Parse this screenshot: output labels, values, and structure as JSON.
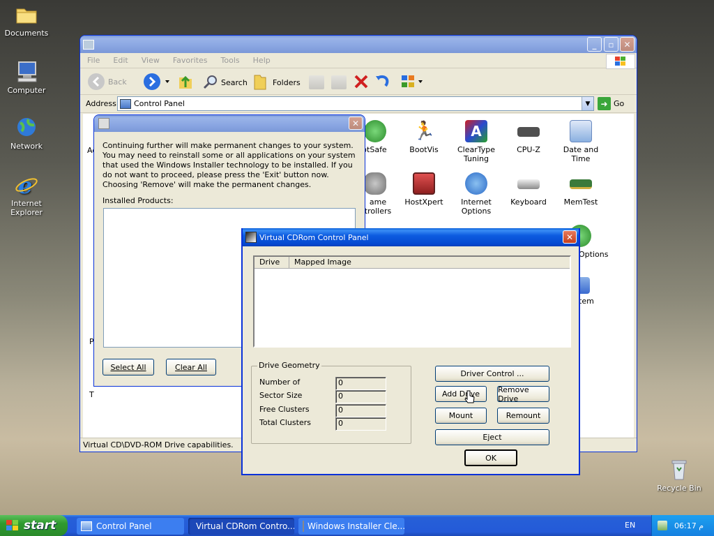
{
  "desktop": {
    "icons": [
      {
        "label": "Documents",
        "icon": "folder-icon"
      },
      {
        "label": "Computer",
        "icon": "computer-icon"
      },
      {
        "label": "Network",
        "icon": "network-icon"
      },
      {
        "label": "Internet Explorer",
        "icon": "ie-icon"
      },
      {
        "label": "Recycle Bin",
        "icon": "recycle-bin-icon"
      }
    ]
  },
  "explorer": {
    "menu": [
      "File",
      "Edit",
      "View",
      "Favorites",
      "Tools",
      "Help"
    ],
    "toolbar": {
      "back": "Back",
      "search": "Search",
      "folders": "Folders"
    },
    "address_label": "Address",
    "address_value": "Control Panel",
    "go": "Go",
    "left_partial": [
      "Ad",
      "P",
      "T"
    ],
    "icons": [
      {
        "label": "otSafe",
        "color": "#3aa63a"
      },
      {
        "label": "BootVis",
        "color": "#e88a10"
      },
      {
        "label": "ClearType Tuning",
        "color": "#c02020"
      },
      {
        "label": "CPU-Z",
        "color": "#505050"
      },
      {
        "label": "Date and Time",
        "color": "#6aa0e0"
      },
      {
        "label": "ame trollers",
        "color": "#707070"
      },
      {
        "label": "HostXpert",
        "color": "#b03030"
      },
      {
        "label": "Internet Options",
        "color": "#3a78c8"
      },
      {
        "label": "Keyboard",
        "color": "#909090"
      },
      {
        "label": "MemTest",
        "color": "#3a7a3a"
      },
      {
        "label": "Options",
        "color": "#2a8a2a"
      },
      {
        "label": "tem",
        "color": "#3a6ad0"
      }
    ],
    "status": "Virtual CD\\DVD-ROM Drive capabilities."
  },
  "installer": {
    "description": "Continuing further will make permanent changes to your system. You may need to reinstall some or all applications on your system that used the Windows Installer technology to be installed. If you do not want to proceed, please press the 'Exit' button now. Choosing 'Remove' will make the permanent changes.",
    "products_label": "Installed Products:",
    "select_all": "Select All",
    "clear_all": "Clear All"
  },
  "vcd": {
    "title": "Virtual CDRom Control Panel",
    "columns": [
      "Drive",
      "Mapped Image"
    ],
    "geometry": {
      "legend": "Drive Geometry",
      "rows": [
        {
          "label": "Number of",
          "value": "0"
        },
        {
          "label": "Sector Size",
          "value": "0"
        },
        {
          "label": "Free Clusters",
          "value": "0"
        },
        {
          "label": "Total Clusters",
          "value": "0"
        }
      ]
    },
    "buttons": {
      "driver_control": "Driver Control ...",
      "add_drive": "Add Drive",
      "remove_drive": "Remove Drive",
      "mount": "Mount",
      "remount": "Remount",
      "eject": "Eject",
      "ok": "OK"
    }
  },
  "taskbar": {
    "start": "start",
    "tasks": [
      "Control Panel",
      "Virtual CDRom Contro...",
      "Windows Installer Cle..."
    ],
    "lang": "EN",
    "time": "06:17 م"
  }
}
